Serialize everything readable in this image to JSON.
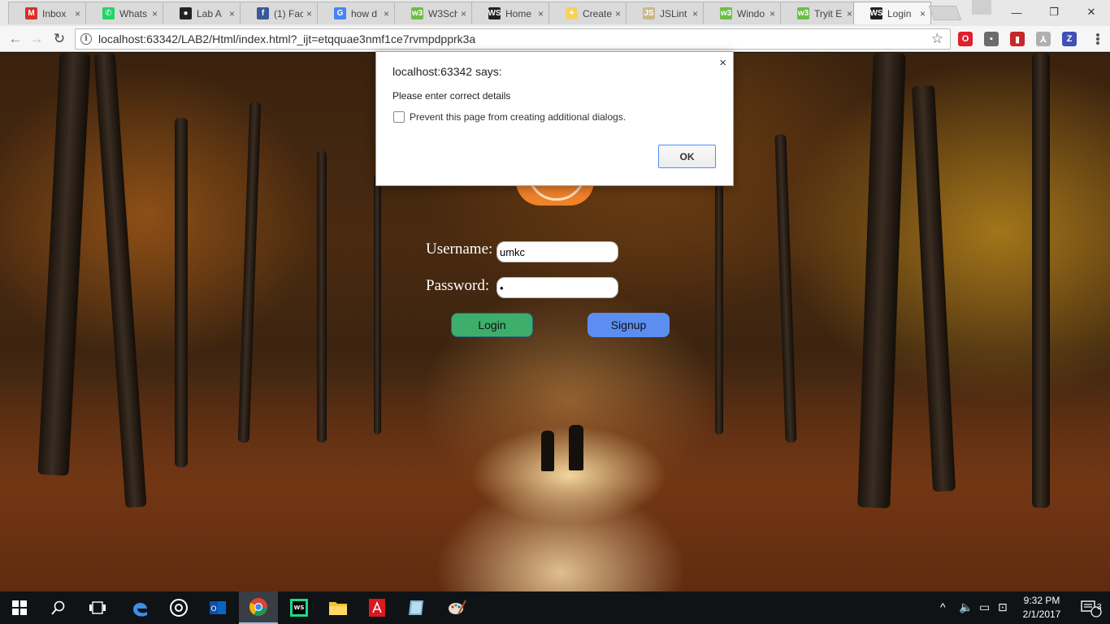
{
  "browser": {
    "tabs": [
      {
        "title": "Inbox",
        "icon": "gmail-icon",
        "color": "#d93025",
        "glyph": "M"
      },
      {
        "title": "Whats",
        "icon": "whatsapp-icon",
        "color": "#25d366",
        "glyph": "✆"
      },
      {
        "title": "Lab A",
        "icon": "github-icon",
        "color": "#222222",
        "glyph": "●"
      },
      {
        "title": "(1) Fac",
        "icon": "facebook-icon",
        "color": "#3b5998",
        "glyph": "f"
      },
      {
        "title": "how d",
        "icon": "google-icon",
        "color": "#4285f4",
        "glyph": "G"
      },
      {
        "title": "W3Sch",
        "icon": "w3schools-icon",
        "color": "#6dbe45",
        "glyph": "w3"
      },
      {
        "title": "Home",
        "icon": "webstorm-icon",
        "color": "#222222",
        "glyph": "WS"
      },
      {
        "title": "Create",
        "icon": "lightbulb-icon",
        "color": "#f4d35e",
        "glyph": "✦"
      },
      {
        "title": "JSLint",
        "icon": "jslint-icon",
        "color": "#c9b98a",
        "glyph": "JS"
      },
      {
        "title": "Windo",
        "icon": "w3schools-icon",
        "color": "#6dbe45",
        "glyph": "w3"
      },
      {
        "title": "Tryit E",
        "icon": "w3schools-icon",
        "color": "#6dbe45",
        "glyph": "w3"
      },
      {
        "title": "Login",
        "icon": "webstorm-icon",
        "color": "#222222",
        "glyph": "WS",
        "active": true
      }
    ],
    "close_glyph": "×",
    "window_controls": {
      "minimize": "—",
      "maximize": "❐",
      "close": "✕"
    },
    "nav": {
      "back": "←",
      "forward": "→",
      "reload": "↻"
    },
    "url": "localhost:63342/LAB2/Html/index.html?_ijt=etqquae3nmf1ce7rvmpdpprk3a",
    "info_glyph": "i",
    "bookmark_glyph": "☆",
    "extensions": [
      {
        "name": "opera-icon",
        "color": "#e0202a",
        "glyph": "O"
      },
      {
        "name": "extension-gray-icon",
        "color": "#6b6b6b",
        "glyph": "▪"
      },
      {
        "name": "book-red-icon",
        "color": "#c62828",
        "glyph": "▮"
      },
      {
        "name": "pdf-icon",
        "color": "#b0b0b0",
        "glyph": "⅄"
      },
      {
        "name": "z-icon",
        "color": "#3f51b5",
        "glyph": "Z"
      }
    ]
  },
  "dialog": {
    "title": "localhost:63342 says:",
    "message": "Please enter correct details",
    "checkbox_label": "Prevent this page from creating additional dialogs.",
    "ok_label": "OK",
    "close_glyph": "×"
  },
  "form": {
    "username_label": "Username:",
    "username_value": "umkc",
    "password_label": "Password:",
    "password_value": "•",
    "login_label": "Login",
    "signup_label": "Signup"
  },
  "taskbar": {
    "time": "9:32 PM",
    "date": "2/1/2017",
    "notification_count": "3",
    "tray": {
      "chevron": "^",
      "volume": "🔈",
      "battery": "▭",
      "network": "⊡"
    }
  }
}
